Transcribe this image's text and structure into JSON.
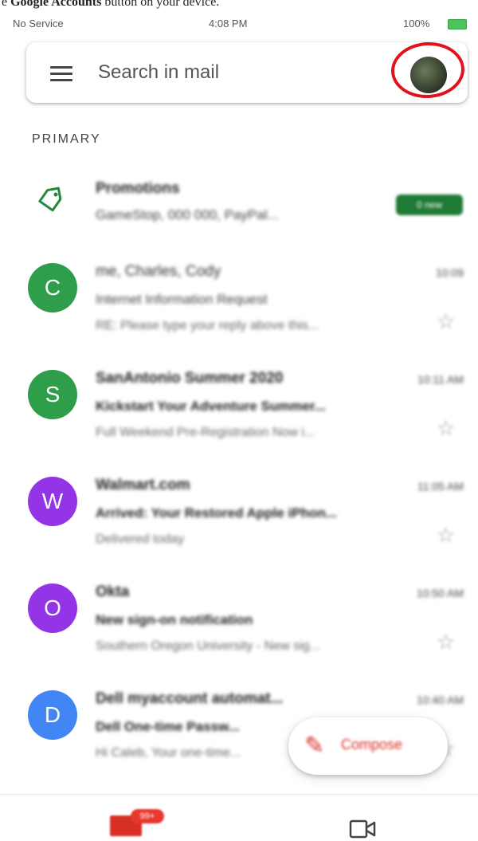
{
  "caption": {
    "prefix": "e ",
    "bold": "Google Accounts",
    "suffix": " button on your device."
  },
  "status_bar": {
    "carrier": "No Service",
    "time": "4:08 PM",
    "battery": "100%"
  },
  "search": {
    "placeholder": "Search in mail"
  },
  "section_label": "PRIMARY",
  "promotions": {
    "title": "Promotions",
    "snippet": "GameStop, 000 000, PayPal...",
    "badge": "0 new",
    "badge_color": "#1f7a36"
  },
  "emails": [
    {
      "initial": "C",
      "color": "#2e9e4a",
      "sender": "me, Charles, Cody",
      "time": "10:09",
      "subject": "Internet Information Request",
      "snippet": "RE: Please type your reply above this...",
      "unread": false
    },
    {
      "initial": "S",
      "color": "#2e9e4a",
      "sender": "SanAntonio Summer 2020",
      "time": "10:11 AM",
      "subject": "Kickstart Your Adventure Summer...",
      "snippet": "Full Weekend Pre-Registration Now i...",
      "unread": true
    },
    {
      "initial": "W",
      "color": "#9334e6",
      "sender": "Walmart.com",
      "time": "11:05 AM",
      "subject": "Arrived: Your Restored Apple iPhon...",
      "snippet": "Delivered today",
      "unread": true
    },
    {
      "initial": "O",
      "color": "#9334e6",
      "sender": "Okta",
      "time": "10:50 AM",
      "subject": "New sign-on notification",
      "snippet": "Southern Oregon University - New sig...",
      "unread": true
    },
    {
      "initial": "D",
      "color": "#4285f4",
      "sender": "Dell myaccount automat...",
      "time": "10:40 AM",
      "subject": "Dell One-time Passw...",
      "snippet": "Hi Caleb, Your one-time...",
      "unread": true
    }
  ],
  "compose": {
    "label": "Compose",
    "color": "#d93025"
  },
  "bottom_nav": {
    "mail_count": "99+",
    "mail_icon": "mail-icon",
    "meet_icon": "video-icon"
  }
}
